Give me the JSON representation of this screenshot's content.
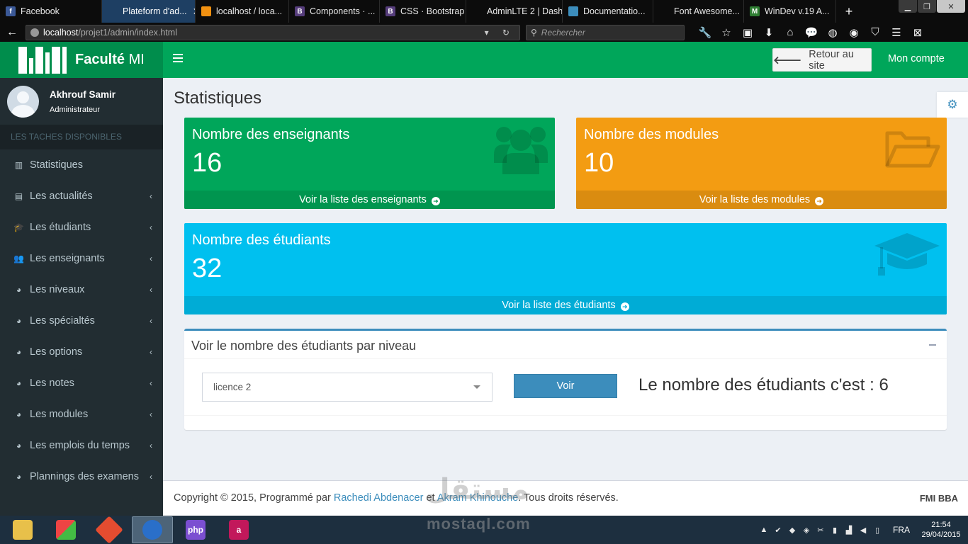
{
  "browser": {
    "tabs": [
      {
        "label": "Facebook",
        "color": "#3b5998",
        "glyph": "f",
        "active": false
      },
      {
        "label": "Plateform d'ad...",
        "color": "#1e3f63",
        "glyph": "",
        "active": true
      },
      {
        "label": "localhost / loca...",
        "color": "#f29111",
        "glyph": "",
        "active": false
      },
      {
        "label": "Components · ...",
        "color": "#563d7c",
        "glyph": "B",
        "active": false
      },
      {
        "label": "CSS · Bootstrap",
        "color": "#563d7c",
        "glyph": "B",
        "active": false
      },
      {
        "label": "AdminLTE 2 | Dash...",
        "color": "#0c0c0c",
        "glyph": "",
        "active": false
      },
      {
        "label": "Documentatio...",
        "color": "#3c8dbc",
        "glyph": "",
        "active": false
      },
      {
        "label": "Font Awesome...",
        "color": "#0c0c0c",
        "glyph": "",
        "active": false
      },
      {
        "label": "WinDev v.19 A...",
        "color": "#2e7d32",
        "glyph": "M",
        "active": false
      }
    ],
    "url_host": "localhost",
    "url_path": "/projet1/admin/index.html",
    "search_placeholder": "Rechercher"
  },
  "app": {
    "logo_bold": "Faculté",
    "logo_rest": " MI",
    "return_label": "Retour au site",
    "account_label": "Mon compte"
  },
  "user": {
    "name": "Akhrouf Samir",
    "role": "Administrateur"
  },
  "sidebar": {
    "header": "LES TACHES DISPONIBLES",
    "items": [
      {
        "label": "Statistiques",
        "icon": "bar-chart-icon",
        "glyph": "▥",
        "has_chevron": false
      },
      {
        "label": "Les actualités",
        "icon": "newspaper-icon",
        "glyph": "▤",
        "has_chevron": true
      },
      {
        "label": "Les étudiants",
        "icon": "graduation-cap-icon",
        "glyph": "🎓",
        "has_chevron": true
      },
      {
        "label": "Les enseignants",
        "icon": "users-icon",
        "glyph": "👥",
        "has_chevron": true
      },
      {
        "label": "Les niveaux",
        "icon": "dashboard-icon",
        "glyph": "◕",
        "has_chevron": true
      },
      {
        "label": "Les spécialtés",
        "icon": "dashboard-icon",
        "glyph": "◕",
        "has_chevron": true
      },
      {
        "label": "Les options",
        "icon": "dashboard-icon",
        "glyph": "◕",
        "has_chevron": true
      },
      {
        "label": "Les notes",
        "icon": "dashboard-icon",
        "glyph": "◕",
        "has_chevron": true
      },
      {
        "label": "Les modules",
        "icon": "dashboard-icon",
        "glyph": "◕",
        "has_chevron": true
      },
      {
        "label": "Les emplois du temps",
        "icon": "dashboard-icon",
        "glyph": "◕",
        "has_chevron": true
      },
      {
        "label": "Plannings des examens",
        "icon": "dashboard-icon",
        "glyph": "◕",
        "has_chevron": true
      }
    ]
  },
  "content": {
    "title": "Statistiques",
    "boxes": {
      "enseignants": {
        "label": "Nombre des enseignants",
        "count": "16",
        "link": "Voir la liste des enseignants",
        "color": "#00a65a"
      },
      "modules": {
        "label": "Nombre des modules",
        "count": "10",
        "link": "Voir la liste des modules",
        "color": "#f39c12"
      },
      "etudiants": {
        "label": "Nombre des étudiants",
        "count": "32",
        "link": "Voir la liste des étudiants",
        "color": "#00c0ef"
      }
    },
    "panel": {
      "title": "Voir le nombre des étudiants par niveau",
      "selected_level": "licence 2",
      "button_label": "Voir",
      "result_text": "Le nombre des étudiants c'est : 6"
    }
  },
  "footer": {
    "copyright_prefix": "Copyright © 2015, Programmé par ",
    "author1": "Rachedi Abdenacer",
    "joiner": " et ",
    "author2": "Akram Khinouche",
    "suffix": ". Tous droits réservés.",
    "brand": "FMI BBA"
  },
  "watermark": {
    "arabic": "مستقل",
    "latin": "mostaql.com"
  },
  "taskbar": {
    "language": "FRA",
    "time": "21:54",
    "date": "29/04/2015"
  }
}
